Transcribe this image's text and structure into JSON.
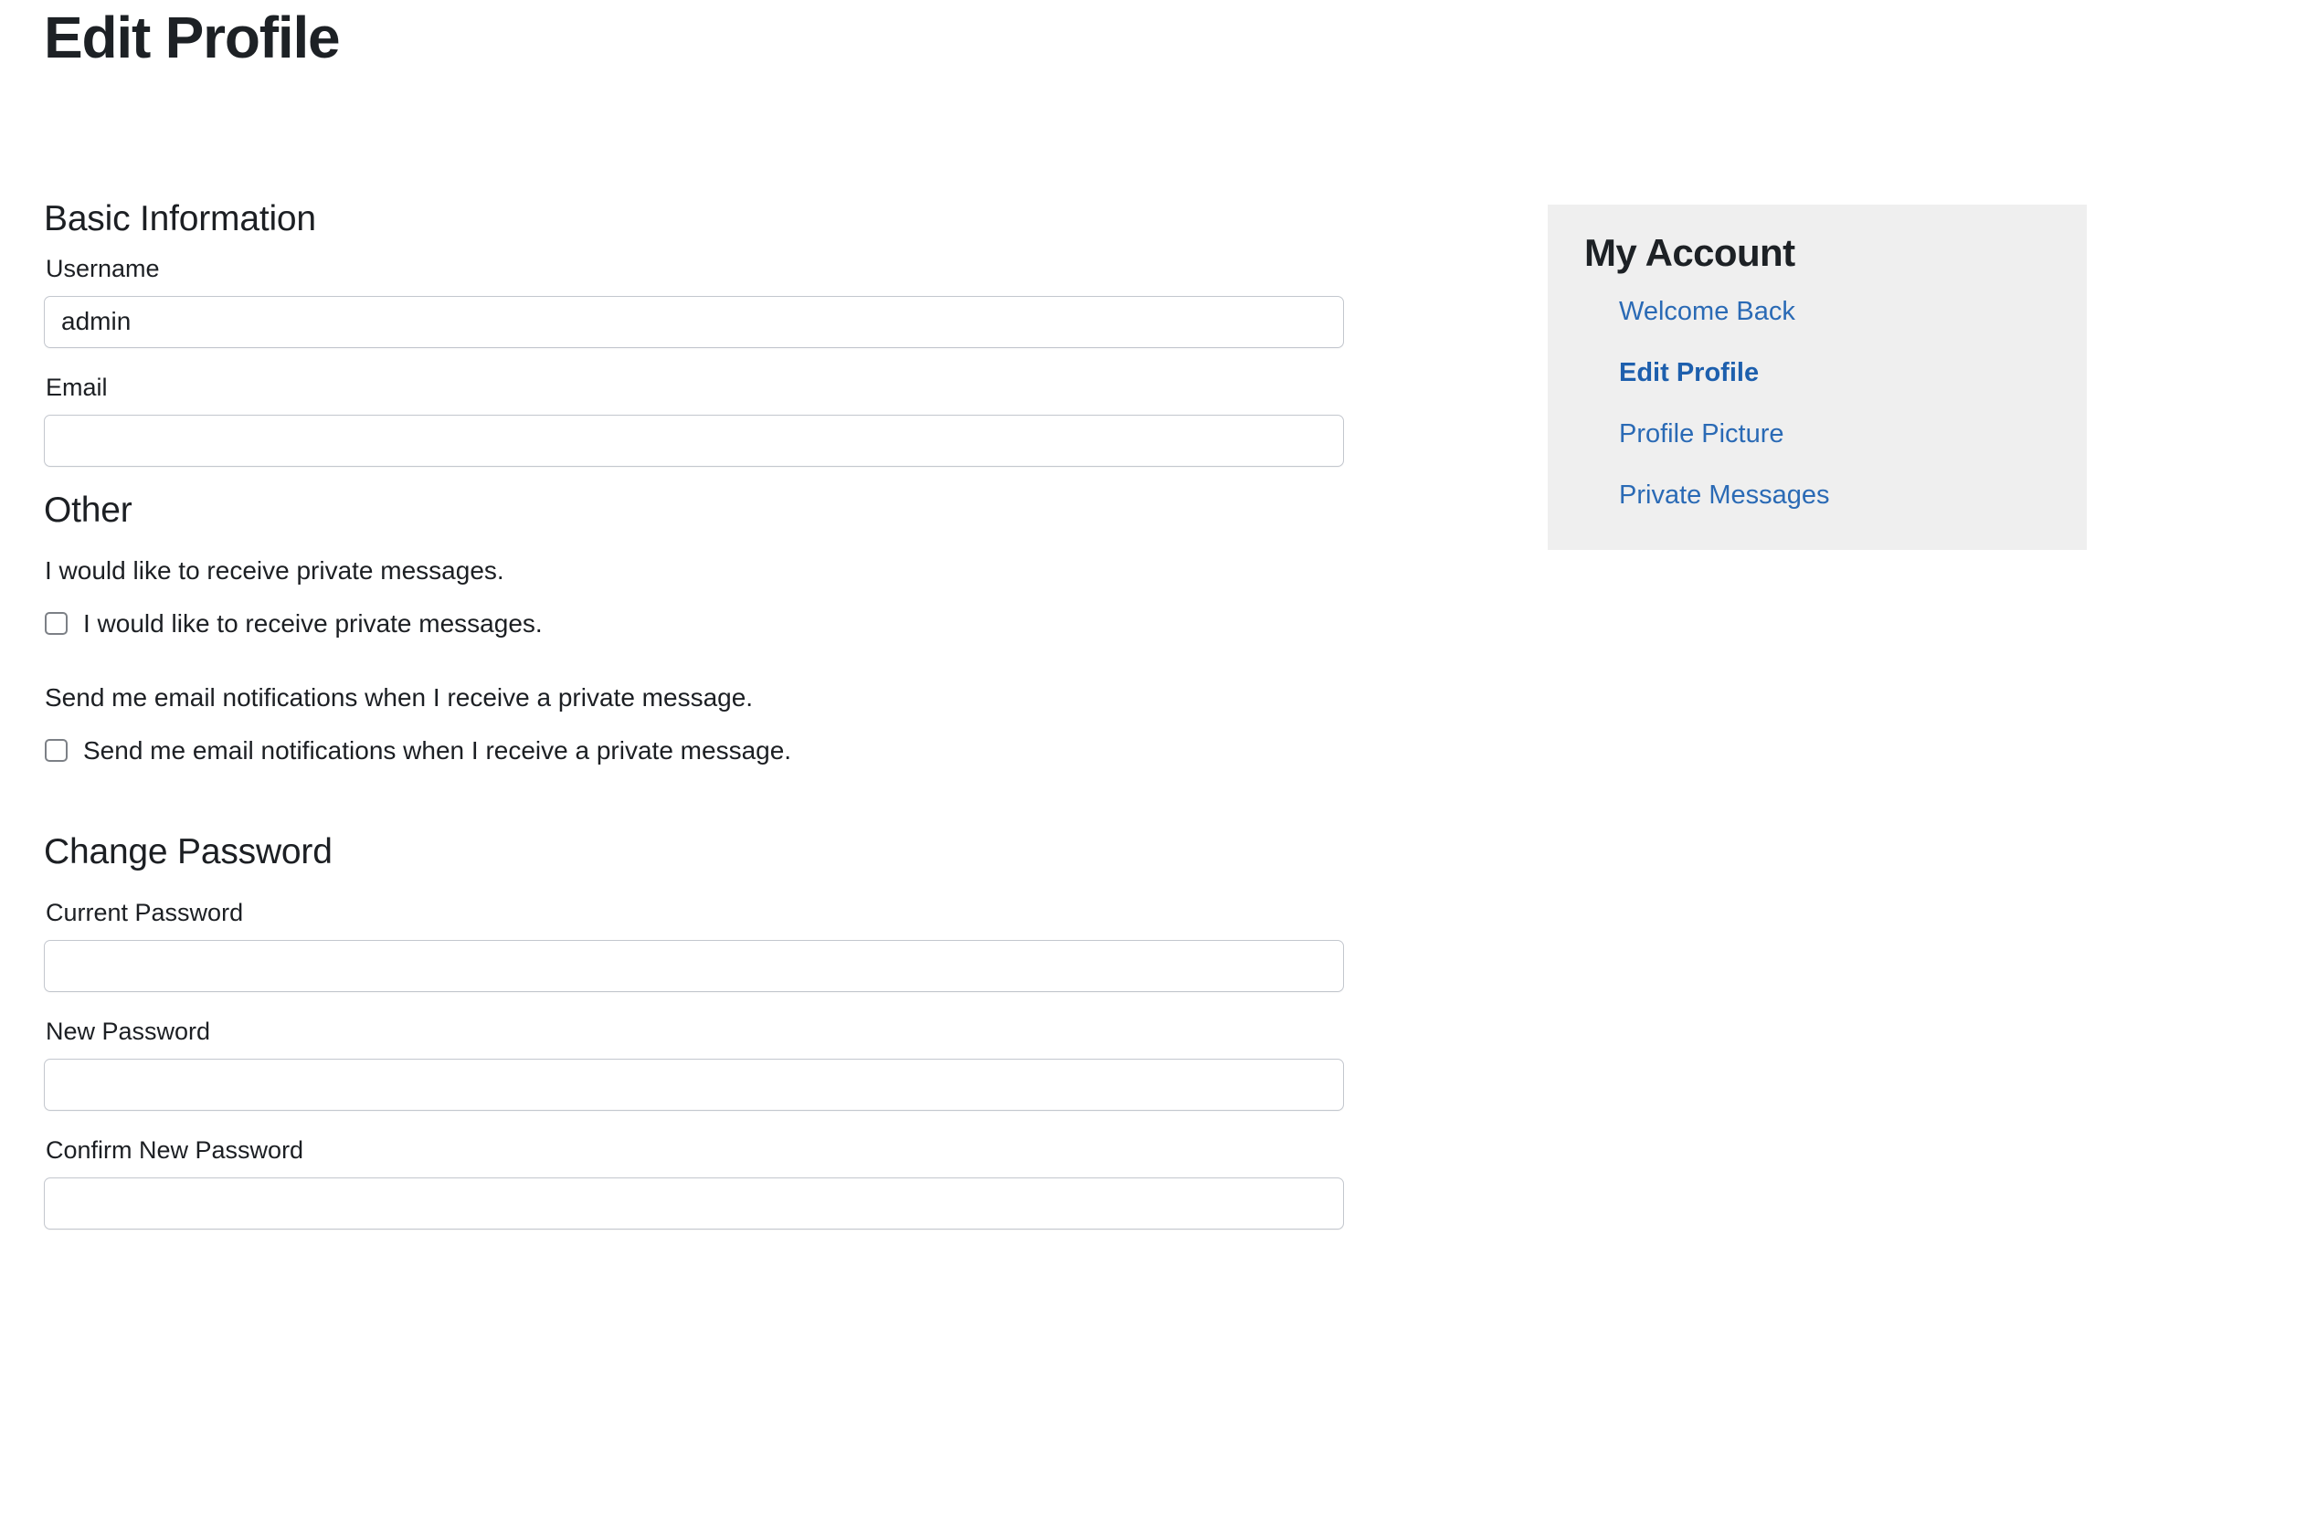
{
  "page": {
    "title": "Edit Profile"
  },
  "basic_information": {
    "heading": "Basic Information",
    "fields": [
      {
        "label": "Username",
        "value": "admin",
        "placeholder": "",
        "type": "text"
      },
      {
        "label": "Email",
        "value": "",
        "placeholder": "",
        "type": "text"
      }
    ]
  },
  "other": {
    "heading": "Other",
    "options": [
      {
        "description": "I would like to receive private messages.",
        "checkbox_label": "I would like to receive private messages.",
        "checked": false
      },
      {
        "description": "Send me email notifications when I receive a private message.",
        "checkbox_label": "Send me email notifications when I receive a private message.",
        "checked": false
      }
    ]
  },
  "change_password": {
    "heading": "Change Password",
    "fields": [
      {
        "label": "Current Password",
        "value": "",
        "placeholder": "",
        "type": "password"
      },
      {
        "label": "New Password",
        "value": "",
        "placeholder": "",
        "type": "password"
      },
      {
        "label": "Confirm New Password",
        "value": "",
        "placeholder": "",
        "type": "password"
      }
    ]
  },
  "sidebar": {
    "title": "My Account",
    "links": [
      {
        "label": "Welcome Back",
        "active": false
      },
      {
        "label": "Edit Profile",
        "active": true
      },
      {
        "label": "Profile Picture",
        "active": false
      },
      {
        "label": "Private Messages",
        "active": false
      }
    ]
  },
  "colors": {
    "link": "#2a6ab5",
    "link_active": "#1d5fad",
    "panel_background": "#efefef",
    "text": "#1c1f23",
    "input_border": "#c3c7ce"
  }
}
